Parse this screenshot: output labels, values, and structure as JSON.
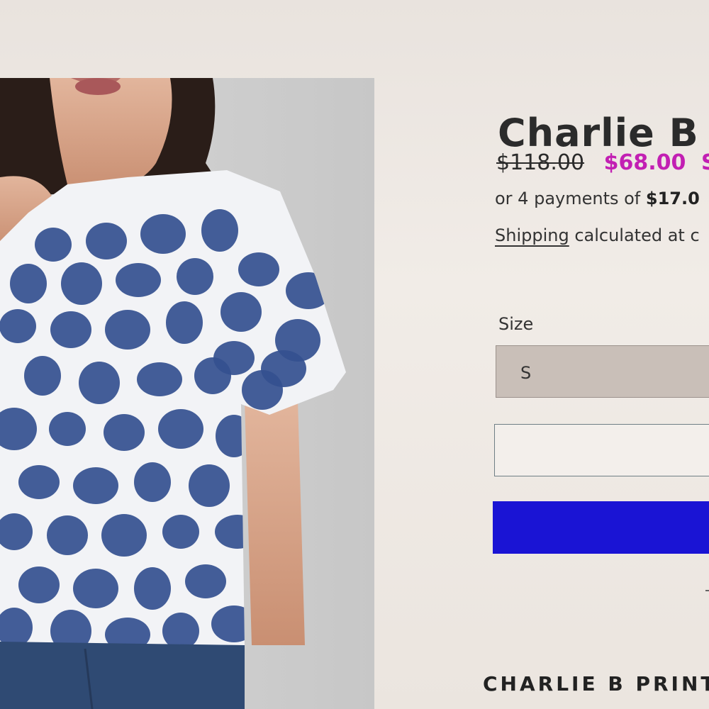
{
  "product": {
    "title": "Charlie B",
    "image_alt": "Woman wearing a white top with navy polka dots"
  },
  "pricing": {
    "compare_at_price": "$118.00",
    "sale_price": "$68.00",
    "sale_badge": "Sa",
    "installments_prefix": "or 4 payments of ",
    "installment_amount": "$17.0"
  },
  "shipping": {
    "link_label": "Shipping",
    "suffix_text": " calculated at c"
  },
  "options": {
    "size_label": "Size",
    "size_value": "S"
  },
  "footer": {
    "brand_heading": "CHARLIE B PRINT"
  },
  "colors": {
    "sale": "#c21fb3",
    "primary_button": "#1a14d4",
    "dot": "#34508f"
  }
}
